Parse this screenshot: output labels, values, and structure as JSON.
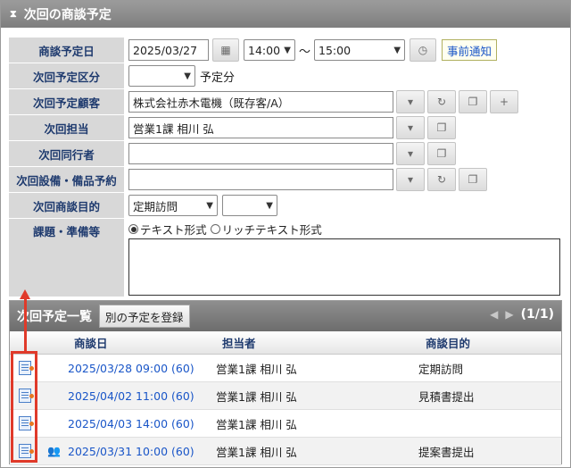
{
  "window": {
    "title": "次回の商談予定"
  },
  "form": {
    "date": {
      "label": "商談予定日",
      "value": "2025/03/27",
      "time_start": "14:00",
      "range_sep": "～",
      "time_end": "15:00",
      "notice_button": "事前通知"
    },
    "category": {
      "label": "次回予定区分",
      "select_value": "",
      "suffix": "予定分"
    },
    "customer": {
      "label": "次回予定顧客",
      "value": "株式会社赤木電機（既存客/A）"
    },
    "owner": {
      "label": "次回担当",
      "value": "営業1課 相川 弘"
    },
    "companion": {
      "label": "次回同行者",
      "value": ""
    },
    "equipment": {
      "label": "次回設備・備品予約",
      "value": ""
    },
    "purpose": {
      "label": "次回商談目的",
      "select_value": "定期訪問",
      "select2_value": ""
    },
    "notes": {
      "label": "課題・準備等",
      "radio_text": "テキスト形式",
      "radio_rich": "リッチテキスト形式"
    }
  },
  "list": {
    "title": "次回予定一覧",
    "register_button": "別の予定を登録",
    "pager": "(1/1)",
    "columns": [
      "商談日",
      "担当者",
      "商談目的"
    ],
    "rows": [
      {
        "date": "2025/03/28 09:00 (60)",
        "owner": "営業1課 相川 弘",
        "purpose": "定期訪問"
      },
      {
        "date": "2025/04/02 11:00 (60)",
        "owner": "営業1課 相川 弘",
        "purpose": "見積書提出"
      },
      {
        "date": "2025/04/03 14:00 (60)",
        "owner": "営業1課 相川 弘",
        "purpose": ""
      },
      {
        "date": "2025/03/31 10:00 (60)",
        "owner": "営業1課 相川 弘",
        "purpose": "提案書提出"
      }
    ]
  },
  "colors": {
    "annotation": "#e03a2a",
    "link": "#1a56c8",
    "label_text": "#1e3a6e"
  }
}
